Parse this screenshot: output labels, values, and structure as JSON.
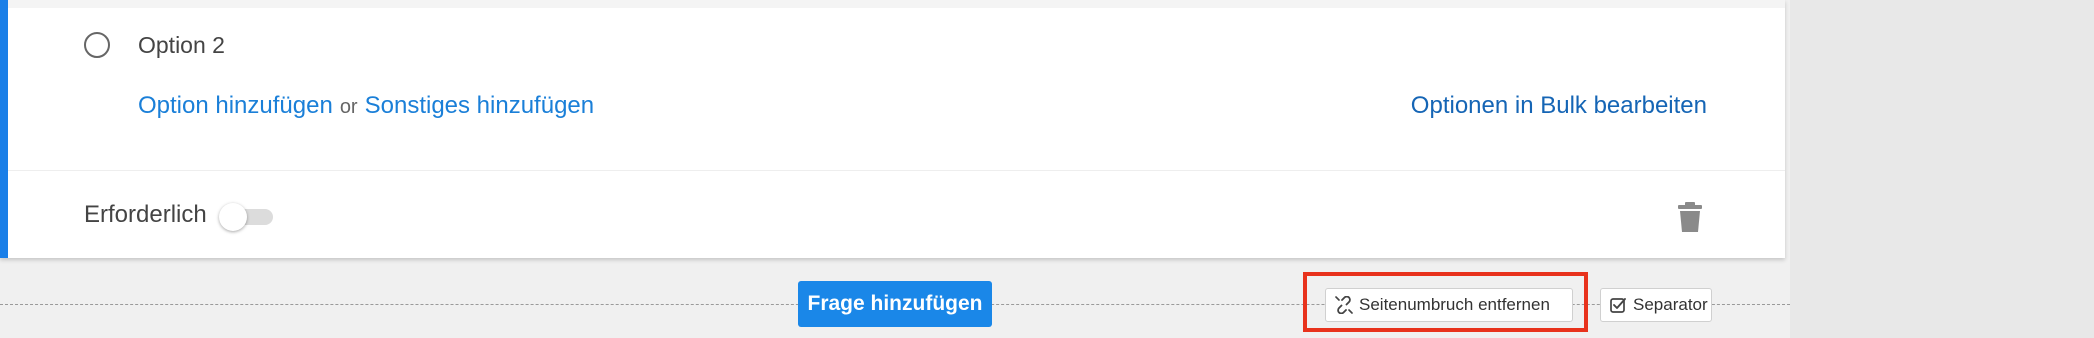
{
  "question": {
    "option_label": "Option 2",
    "add_option_link": "Option hinzufügen",
    "or_text": "or",
    "add_other_link": "Sonstiges hinzufügen",
    "bulk_edit_link": "Optionen in Bulk bearbeiten",
    "required_label": "Erforderlich",
    "required_enabled": false
  },
  "footer": {
    "add_question_label": "Frage hinzufügen",
    "remove_page_break_label": "Seitenumbruch entfernen",
    "separator_label": "Separator"
  },
  "icons": {
    "delete": "trash-icon",
    "page_break": "unlink-icon",
    "separator": "checkbox-icon"
  },
  "colors": {
    "accent": "#1a7fe8",
    "link": "#1a7fd8",
    "button": "#1a87e8",
    "highlight": "#e8321c"
  }
}
